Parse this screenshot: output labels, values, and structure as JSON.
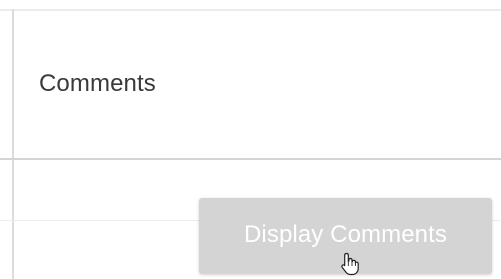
{
  "section": {
    "title": "Comments"
  },
  "actions": {
    "display_comments_label": "Display Comments"
  },
  "colors": {
    "button_bg": "#d4d4d4",
    "button_text": "#ffffff",
    "title_text": "#3a3a3a",
    "divider": "#d4d4d4"
  },
  "icons": {
    "cursor": "hand-pointer-icon"
  }
}
